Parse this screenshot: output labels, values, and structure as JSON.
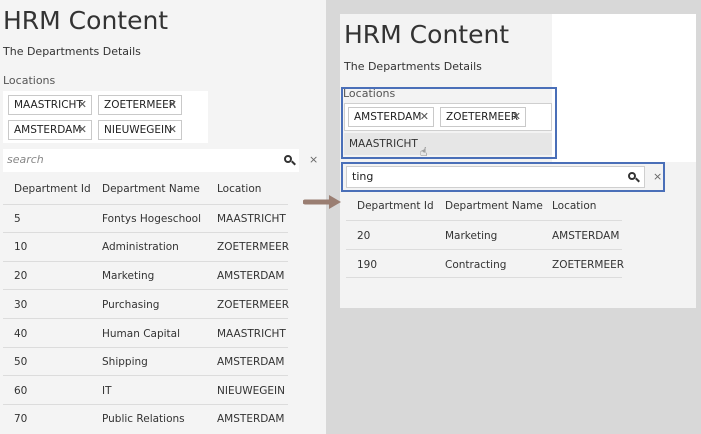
{
  "left": {
    "app_title": "HRM Content",
    "subtitle": "The Departments Details",
    "locations_label": "Locations",
    "chips": [
      "MAASTRICHT",
      "ZOETERMEER",
      "AMSTERDAM",
      "NIEUWEGEIN"
    ],
    "search_placeholder": "search",
    "clear_symbol": "×",
    "columns": [
      "Department Id",
      "Department Name",
      "Location"
    ],
    "rows": [
      [
        "5",
        "Fontys Hogeschool",
        "MAASTRICHT"
      ],
      [
        "10",
        "Administration",
        "ZOETERMEER"
      ],
      [
        "20",
        "Marketing",
        "AMSTERDAM"
      ],
      [
        "30",
        "Purchasing",
        "ZOETERMEER"
      ],
      [
        "40",
        "Human Capital",
        "MAASTRICHT"
      ],
      [
        "50",
        "Shipping",
        "AMSTERDAM"
      ],
      [
        "60",
        "IT",
        "NIEUWEGEIN"
      ],
      [
        "70",
        "Public Relations",
        "AMSTERDAM"
      ]
    ]
  },
  "right": {
    "app_title": "HRM Content",
    "subtitle": "The Departments Details",
    "locations_label": "Locations",
    "chips": [
      "AMSTERDAM",
      "ZOETERMEER"
    ],
    "dropdown_option": "MAASTRICHT",
    "search_value": "ting",
    "clear_symbol": "×",
    "columns": [
      "Department Id",
      "Department Name",
      "Location"
    ],
    "rows": [
      [
        "20",
        "Marketing",
        "AMSTERDAM"
      ],
      [
        "190",
        "Contracting",
        "ZOETERMEER"
      ]
    ]
  },
  "chip_remove_symbol": "✕",
  "colors": {
    "highlight_border": "#4a6fb8",
    "arrow": "#9a7e72"
  }
}
